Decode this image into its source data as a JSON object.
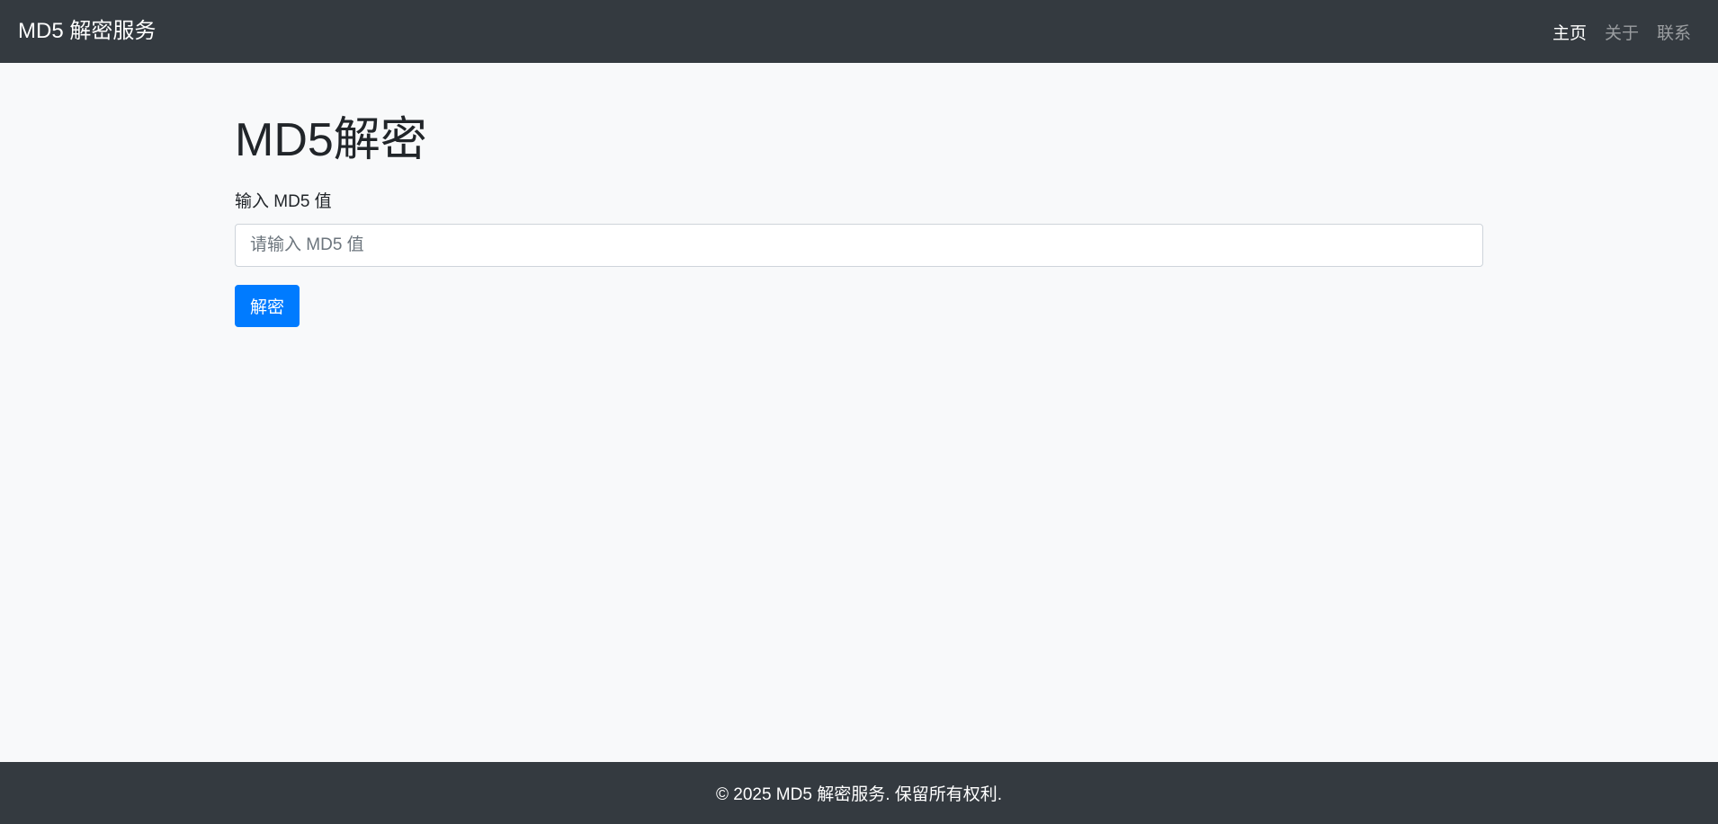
{
  "navbar": {
    "brand": "MD5 解密服务",
    "links": [
      {
        "label": "主页",
        "active": true
      },
      {
        "label": "关于",
        "active": false
      },
      {
        "label": "联系",
        "active": false
      }
    ]
  },
  "main": {
    "title": "MD5解密",
    "input_label": "输入 MD5 值",
    "input_placeholder": "请输入 MD5 值",
    "input_value": "",
    "button_label": "解密"
  },
  "footer": {
    "text": "© 2025 MD5 解密服务. 保留所有权利."
  },
  "colors": {
    "navbar_bg": "#343a40",
    "page_bg": "#f8f9fa",
    "primary": "#007bff",
    "text": "#212529",
    "nav_inactive": "rgba(255,255,255,0.5)"
  }
}
